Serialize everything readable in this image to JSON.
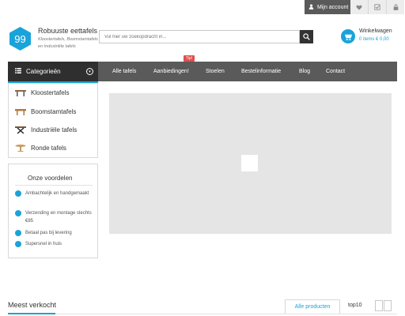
{
  "topbar": {
    "account_label": "Mijn account",
    "icons": [
      "user-icon",
      "heart-icon",
      "checklist-icon",
      "lock-icon"
    ]
  },
  "header": {
    "logo_text": "99",
    "title": "Robuuste eettafels",
    "subtitle": "Kloostertafels, Boomstamtafels en Industriële tafels",
    "search_placeholder": "Vul hier uw zoekopdracht in...",
    "cart_title": "Winkelwagen",
    "cart_summary": "0 items € 0,00"
  },
  "nav": {
    "categories_label": "Categorieën",
    "items": [
      "Alle tafels",
      "Aanbiedingen!",
      "Stoelen",
      "Bestelinformatie",
      "Blog",
      "Contact"
    ],
    "tip_badge": "Tip!"
  },
  "categories": [
    {
      "label": "Kloostertafels",
      "icon": "klooster-table-icon"
    },
    {
      "label": "Boomstamtafels",
      "icon": "boomstam-table-icon"
    },
    {
      "label": "Industriële tafels",
      "icon": "industrial-table-icon"
    },
    {
      "label": "Ronde tafels",
      "icon": "round-table-icon"
    }
  ],
  "voordelen": {
    "title": "Onze voordelen",
    "items": [
      "Ambachtelijk en handgemaakt",
      "Verzending en montage slechts €85",
      "Betaal pas bij levering",
      "Supersnel in huis"
    ]
  },
  "bottom": {
    "section_title": "Meest verkocht",
    "tabs": [
      "Alle producten",
      "top10"
    ]
  },
  "colors": {
    "accent": "#1aa3d9",
    "nav": "#5a5a5a",
    "nav_dark": "#2f2f2f",
    "tip": "#e04f4f"
  }
}
